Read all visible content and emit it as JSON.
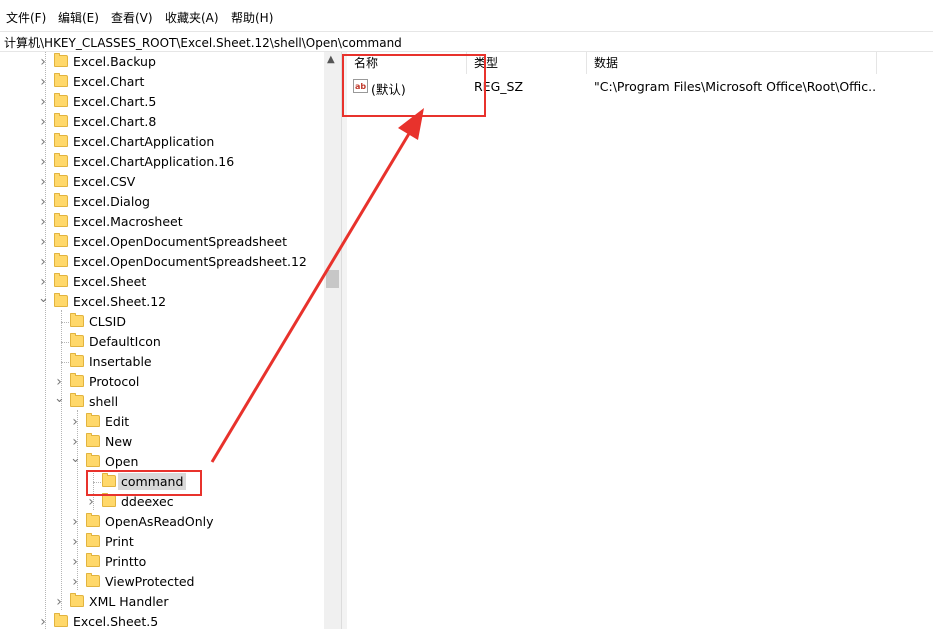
{
  "menu": [
    "文件(F)",
    "编辑(E)",
    "查看(V)",
    "收藏夹(A)",
    "帮助(H)"
  ],
  "address": "计算机\\HKEY_CLASSES_ROOT\\Excel.Sheet.12\\shell\\Open\\command",
  "tree": {
    "items": [
      {
        "label": "Excel.Backup",
        "level": 0,
        "expander": "collapsed"
      },
      {
        "label": "Excel.Chart",
        "level": 0,
        "expander": "collapsed"
      },
      {
        "label": "Excel.Chart.5",
        "level": 0,
        "expander": "collapsed"
      },
      {
        "label": "Excel.Chart.8",
        "level": 0,
        "expander": "collapsed"
      },
      {
        "label": "Excel.ChartApplication",
        "level": 0,
        "expander": "collapsed"
      },
      {
        "label": "Excel.ChartApplication.16",
        "level": 0,
        "expander": "collapsed"
      },
      {
        "label": "Excel.CSV",
        "level": 0,
        "expander": "collapsed"
      },
      {
        "label": "Excel.Dialog",
        "level": 0,
        "expander": "collapsed"
      },
      {
        "label": "Excel.Macrosheet",
        "level": 0,
        "expander": "collapsed"
      },
      {
        "label": "Excel.OpenDocumentSpreadsheet",
        "level": 0,
        "expander": "collapsed"
      },
      {
        "label": "Excel.OpenDocumentSpreadsheet.12",
        "level": 0,
        "expander": "collapsed"
      },
      {
        "label": "Excel.Sheet",
        "level": 0,
        "expander": "collapsed"
      },
      {
        "label": "Excel.Sheet.12",
        "level": 0,
        "expander": "expanded"
      },
      {
        "label": "CLSID",
        "level": 1,
        "expander": "none"
      },
      {
        "label": "DefaultIcon",
        "level": 1,
        "expander": "none"
      },
      {
        "label": "Insertable",
        "level": 1,
        "expander": "none"
      },
      {
        "label": "Protocol",
        "level": 1,
        "expander": "collapsed"
      },
      {
        "label": "shell",
        "level": 1,
        "expander": "expanded"
      },
      {
        "label": "Edit",
        "level": 2,
        "expander": "collapsed"
      },
      {
        "label": "New",
        "level": 2,
        "expander": "collapsed"
      },
      {
        "label": "Open",
        "level": 2,
        "expander": "expanded"
      },
      {
        "label": "command",
        "level": 3,
        "expander": "none",
        "selected": true
      },
      {
        "label": "ddeexec",
        "level": 3,
        "expander": "collapsed"
      },
      {
        "label": "OpenAsReadOnly",
        "level": 2,
        "expander": "collapsed"
      },
      {
        "label": "Print",
        "level": 2,
        "expander": "collapsed"
      },
      {
        "label": "Printto",
        "level": 2,
        "expander": "collapsed"
      },
      {
        "label": "ViewProtected",
        "level": 2,
        "expander": "collapsed"
      },
      {
        "label": "XML Handler",
        "level": 1,
        "expander": "collapsed"
      },
      {
        "label": "Excel.Sheet.5",
        "level": 0,
        "expander": "collapsed"
      }
    ]
  },
  "list": {
    "headers": {
      "name": "名称",
      "type": "类型",
      "data": "数据"
    },
    "rows": [
      {
        "icon": "ab",
        "name": "(默认)",
        "type": "REG_SZ",
        "data": "\"C:\\Program Files\\Microsoft Office\\Root\\Offic..."
      }
    ]
  },
  "colors": {
    "annotation": "#e8322c",
    "folder": "#ffd86a",
    "selection": "#d9d9d9"
  },
  "icons": [
    "folder-icon",
    "chevron-right-icon",
    "chevron-down-icon",
    "string-value-icon",
    "scroll-up-arrow-icon"
  ]
}
